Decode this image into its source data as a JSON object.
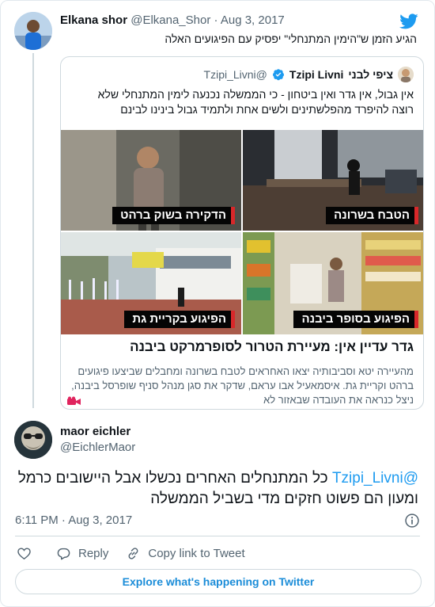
{
  "parent_tweet": {
    "author_name": "Elkana shor",
    "handle": "@Elkana_Shor",
    "separator": "·",
    "date": "Aug 3, 2017",
    "text": "הגיע הזמן ש\"הימין המתנחלי\" יפסיק עם הפיגועים האלה"
  },
  "quoted_tweet": {
    "author_name": "Tzipi Livni",
    "author_name_hebrew": "ציפי לבני",
    "handle": "@Tzipi_Livni",
    "text": "אין גבול, אין גדר ואין ביטחון - כי הממשלה נכנעה לימין המתנחלי שלא רוצה להיפרד מהפלשתינים ולשים אחת ולתמיד גבול בינינו לבינם",
    "collage_labels": [
      "הטבח בשרונה",
      "הדקירה בשוק ברהט",
      "הפיגוע בסופר ביבנה",
      "הפיגוע בקריית גת"
    ],
    "card_title": "גדר עדיין אין: מעיירת הטרור לסופרמרקט ביבנה",
    "card_description": "מהעיירה יטא וסביבותיה יצאו האחראים לטבח בשרונה ומחבלים שביצעו פיגועים ברהט וקריית גת. איסמאעיל אבו עראם, שדקר את סגן מנהל סניף שופרסל ביבנה, ניצל כנראה את העובדה שבאזור לא"
  },
  "reply_tweet": {
    "author_name": "maor eichler",
    "handle": "@EichlerMaor",
    "mention": "@Tzipi_Livni",
    "text": "כל המתנחלים האחרים נכשלו אבל היישובים כרמל ומעון הם פשוט חזקים מדי בשביל הממשלה",
    "time": "6:11 PM",
    "separator": "·",
    "date": "Aug 3, 2017"
  },
  "actions": {
    "like_label": "",
    "reply_label": "Reply",
    "copy_link_label": "Copy link to Tweet"
  },
  "explore_label": "Explore what's happening on Twitter",
  "icons": {
    "twitter_bird": "twitter-bird-icon",
    "verified": "verified-badge-icon",
    "info": "info-icon",
    "heart": "heart-icon",
    "reply": "reply-bubble-icon",
    "link": "link-icon",
    "video": "video-camera-icon"
  },
  "colors": {
    "twitter_blue": "#1d9bf0",
    "text": "#0f1419",
    "muted": "#536471",
    "border": "#cfd9de",
    "label_accent": "#d8282a"
  }
}
